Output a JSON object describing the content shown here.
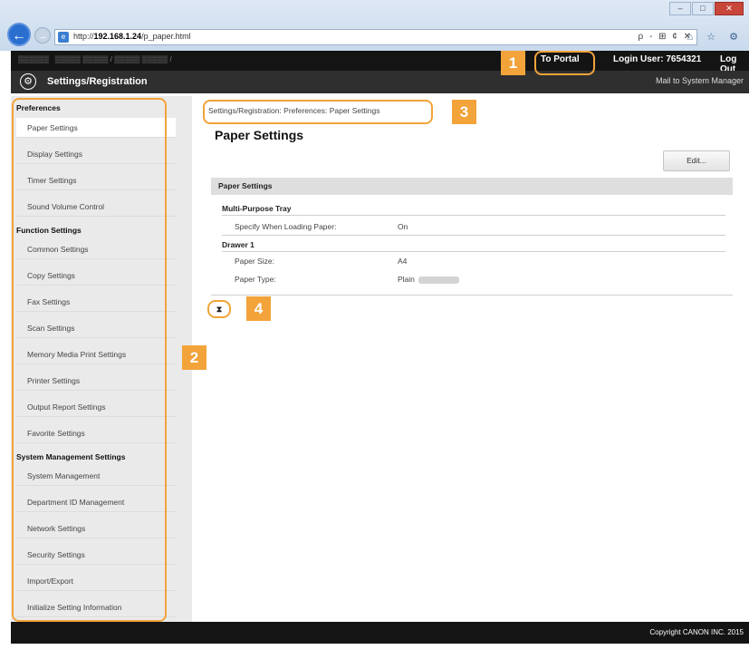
{
  "browser": {
    "url_prefix": "http://",
    "url_host": "192.168.1.24",
    "url_path": "/p_paper.html",
    "address_tools": "ρ - ⊞ ¢ ✕",
    "right_icons": "⌂ ☆ ⚙"
  },
  "header": {
    "to_portal": "To Portal",
    "login_user": "Login User:  7654321",
    "log_out": "Log Out",
    "title": "Settings/Registration",
    "mail": "Mail to System Manager"
  },
  "sidebar": {
    "sections": [
      {
        "label": "Preferences",
        "items": [
          "Paper Settings",
          "Display Settings",
          "Timer Settings",
          "Sound Volume Control"
        ]
      },
      {
        "label": "Function Settings",
        "items": [
          "Common Settings",
          "Copy Settings",
          "Fax Settings",
          "Scan Settings",
          "Memory Media Print Settings",
          "Printer Settings",
          "Output Report Settings",
          "Favorite Settings"
        ]
      },
      {
        "label": "System Management Settings",
        "items": [
          "System Management",
          "Department ID Management",
          "Network Settings",
          "Security Settings",
          "Import/Export",
          "Initialize Setting Information"
        ]
      }
    ]
  },
  "main": {
    "breadcrumb": "Settings/Registration: Preferences: Paper Settings",
    "page_title": "Paper Settings",
    "edit_label": "Edit...",
    "section_label": "Paper Settings",
    "groups": [
      {
        "label": "Multi-Purpose Tray",
        "rows": [
          {
            "label": "Specify When Loading Paper:",
            "value": "On"
          }
        ]
      },
      {
        "label": "Drawer 1",
        "rows": [
          {
            "label": "Paper Size:",
            "value": "A4"
          },
          {
            "label": "Paper Type:",
            "value": "Plain"
          }
        ]
      }
    ],
    "top_glyph": "⧗"
  },
  "callouts": {
    "c1": "1",
    "c2": "2",
    "c3": "3",
    "c4": "4"
  },
  "footer": {
    "copyright": "Copyright CANON INC. 2015"
  },
  "colors": {
    "accent": "#f2a33a",
    "header": "#141414",
    "sidebar": "#eaeaea"
  }
}
